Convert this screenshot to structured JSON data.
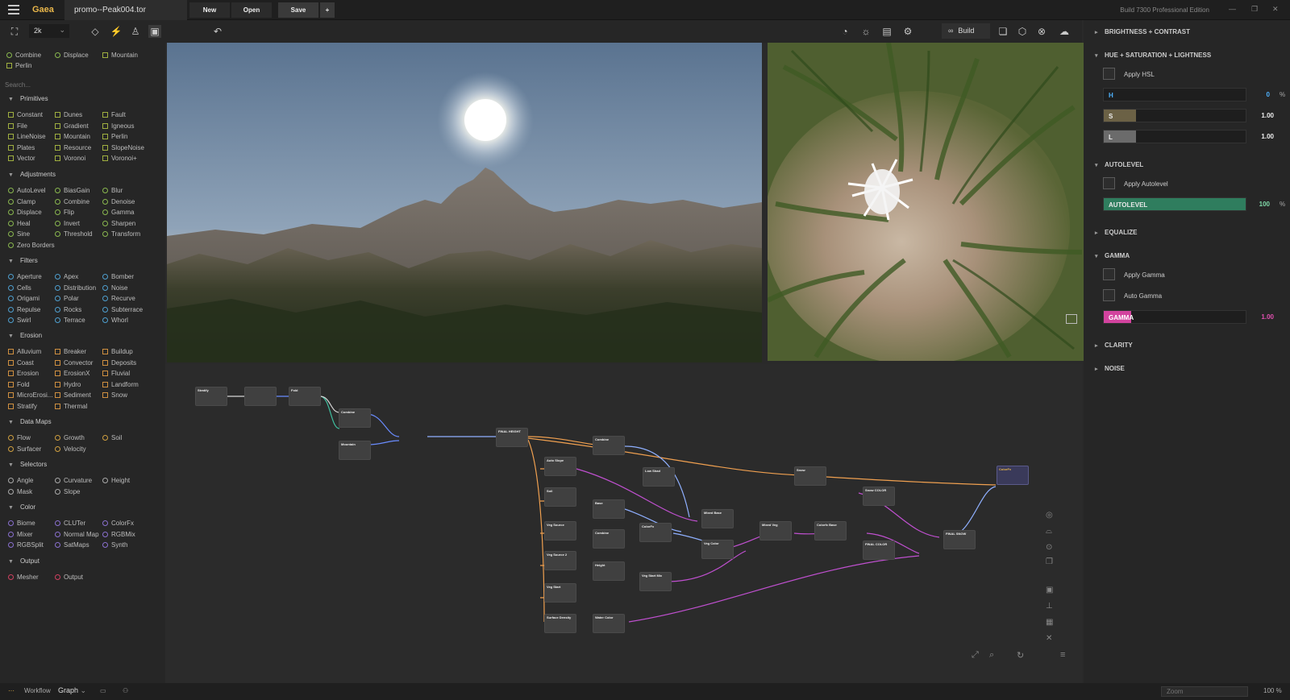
{
  "app": {
    "title": "Gaea",
    "filename": "promo--Peak004.tor",
    "build": "Build 7300 Professional Edition",
    "buttons": {
      "new": "New",
      "open": "Open",
      "save": "Save",
      "add": "+"
    }
  },
  "toolbar": {
    "resolution": "2k",
    "build_label": "Build"
  },
  "left": {
    "favorites": [
      "Combine",
      "Displace",
      "Mountain",
      "Perlin"
    ],
    "search_placeholder": "Search...",
    "categories": {
      "primitives": {
        "label": "Primitives",
        "items": [
          "Constant",
          "Dunes",
          "Fault",
          "File",
          "Gradient",
          "Igneous",
          "LineNoise",
          "Mountain",
          "Perlin",
          "Plates",
          "Resource",
          "SlopeNoise",
          "Vector",
          "Voronoi",
          "Voronoi+"
        ]
      },
      "adjustments": {
        "label": "Adjustments",
        "items": [
          "AutoLevel",
          "BiasGain",
          "Blur",
          "Clamp",
          "Combine",
          "Denoise",
          "Displace",
          "Flip",
          "Gamma",
          "Heal",
          "Invert",
          "Sharpen",
          "Sine",
          "Threshold",
          "Transform",
          "Zero Borders"
        ]
      },
      "filters": {
        "label": "Filters",
        "items": [
          "Aperture",
          "Apex",
          "Bomber",
          "Cells",
          "Distribution",
          "Noise",
          "Origami",
          "Polar",
          "Recurve",
          "Repulse",
          "Rocks",
          "Subterrace",
          "Swirl",
          "Terrace",
          "Whorl"
        ]
      },
      "erosion": {
        "label": "Erosion",
        "items": [
          "Alluvium",
          "Breaker",
          "Buildup",
          "Coast",
          "Convector",
          "Deposits",
          "Erosion",
          "ErosionX",
          "Fluvial",
          "Fold",
          "Hydro",
          "Landform",
          "MicroErosi...",
          "Sediment",
          "Snow",
          "Stratify",
          "Thermal"
        ]
      },
      "datamaps": {
        "label": "Data Maps",
        "items": [
          "Flow",
          "Growth",
          "Soil",
          "Surfacer",
          "Velocity"
        ]
      },
      "selectors": {
        "label": "Selectors",
        "items": [
          "Angle",
          "Curvature",
          "Height",
          "Mask",
          "Slope"
        ]
      },
      "color": {
        "label": "Color",
        "items": [
          "Biome",
          "CLUTer",
          "ColorFx",
          "Mixer",
          "Normal Map",
          "RGBMix",
          "RGBSplit",
          "SatMaps",
          "Synth"
        ]
      },
      "output": {
        "label": "Output",
        "items": [
          "Mesher",
          "Output"
        ]
      }
    }
  },
  "graph": {
    "nodes": [
      "Stratify",
      "Fold",
      "Combine",
      "Mountain",
      "FINAL HEIGHT",
      "Combine",
      "Auto Slope",
      "Soil",
      "Veg Source",
      "Veg Source 2",
      "Veg Start",
      "Surface Density",
      "Low Shad",
      "Base",
      "Combine",
      "Height",
      "Water Color",
      "ColorFx",
      "Veg Start Mix",
      "Mixed Base",
      "Veg Color",
      "Mixed Veg",
      "Colorfx Base",
      "Snow",
      "Snow COLOR",
      "FINAL COLOR",
      "FINAL SNOW",
      "ColorFx"
    ]
  },
  "right": {
    "sections": {
      "brightness": "BRIGHTNESS + CONTRAST",
      "hsl": "HUE + SATURATION + LIGHTNESS",
      "autolevel": "AUTOLEVEL",
      "equalize": "EQUALIZE",
      "gamma": "GAMMA",
      "clarity": "CLARITY",
      "noise": "NOISE"
    },
    "apply_hsl": "Apply HSL",
    "h": {
      "label": "H",
      "value": "0",
      "unit": "%"
    },
    "s": {
      "label": "S",
      "value": "1.00"
    },
    "l": {
      "label": "L",
      "value": "1.00"
    },
    "apply_autolevel": "Apply Autolevel",
    "autolevel": {
      "label": "AUTOLEVEL",
      "value": "100",
      "unit": "%"
    },
    "apply_gamma": "Apply Gamma",
    "auto_gamma": "Auto Gamma",
    "gamma": {
      "label": "GAMMA",
      "value": "1.00"
    }
  },
  "status": {
    "workflow": "Workflow",
    "mode": "Graph",
    "zoom_placeholder": "Zoom",
    "zoom_value": "100",
    "zoom_unit": "%"
  },
  "colors": {
    "accent": "#e9b64a",
    "hue": "#4fb3ff",
    "autolevel": "#2f7d5e",
    "gamma": "#e04fb0"
  }
}
